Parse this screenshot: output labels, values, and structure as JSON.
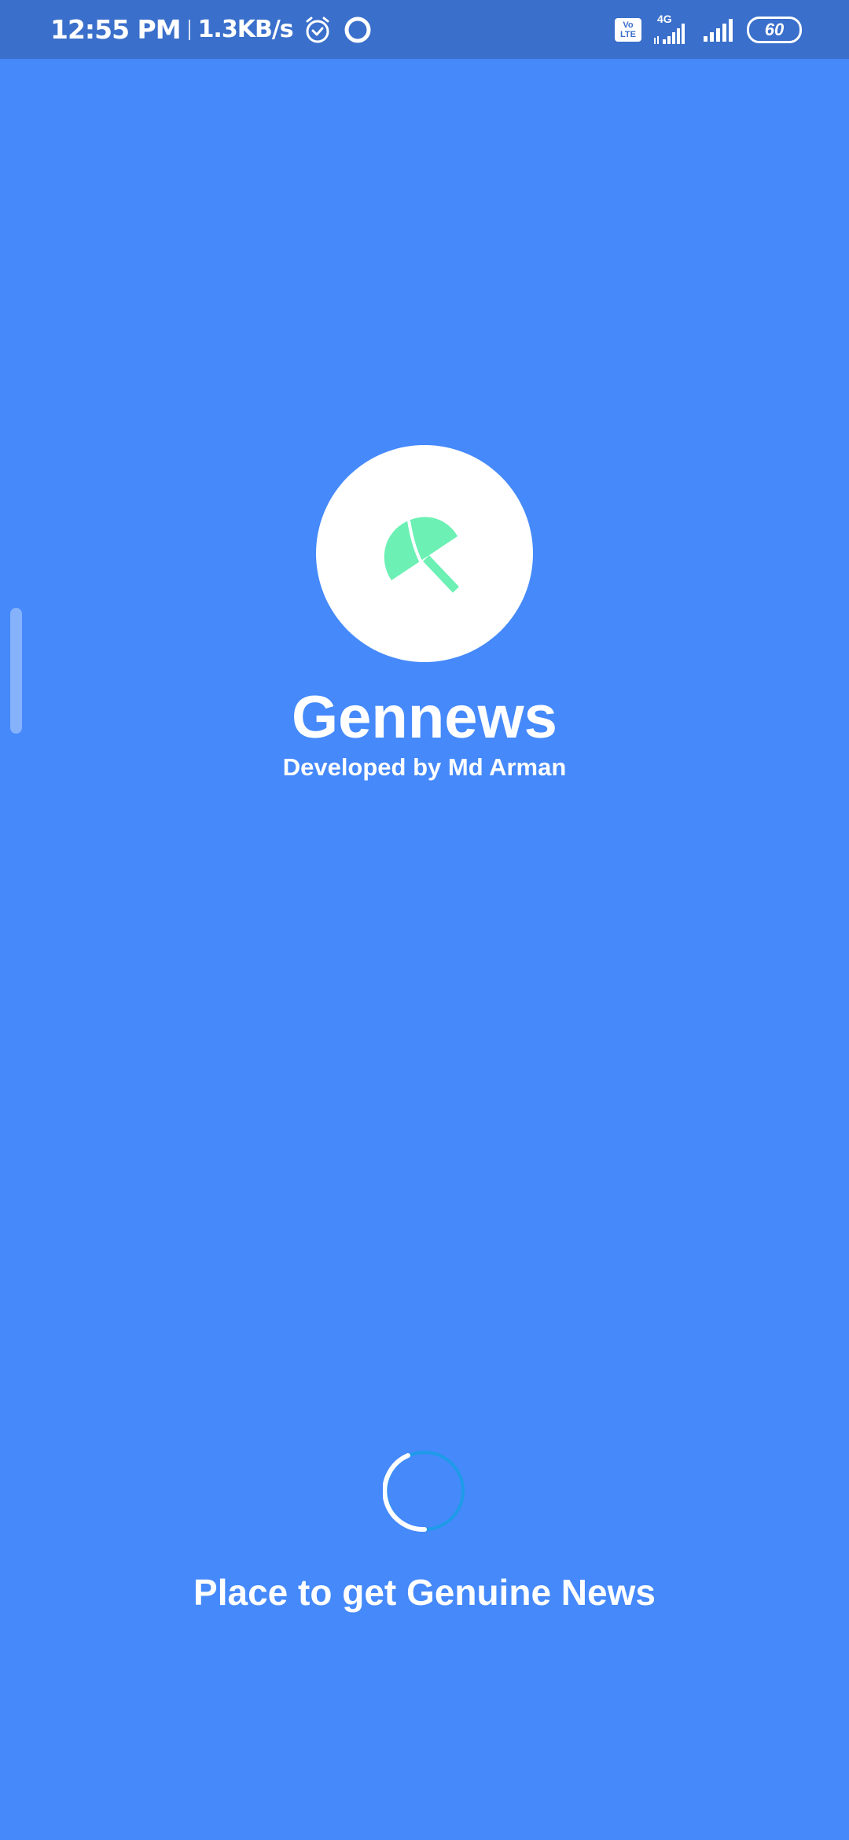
{
  "status_bar": {
    "time": "12:55 PM",
    "net_speed": "1.3KB/s",
    "icons": [
      "alarm-icon",
      "ring-icon",
      "volte-icon",
      "signal-icon",
      "signal-icon"
    ],
    "volte_line1": "Vo",
    "volte_line2": "LTE",
    "network_type": "4G",
    "battery": "60"
  },
  "splash": {
    "logo_icon": "umbrella-icon",
    "title": "Gennews",
    "developer": "Developed by Md Arman",
    "tagline": "Place to get Genuine News"
  },
  "colors": {
    "background": "#4589fb",
    "status_bar": "#3a6fcb",
    "logo_circle": "#ffffff",
    "logo_icon": "#6cf0b4",
    "spinner_track": "#ffffff",
    "spinner_arc": "#1e9be8"
  }
}
